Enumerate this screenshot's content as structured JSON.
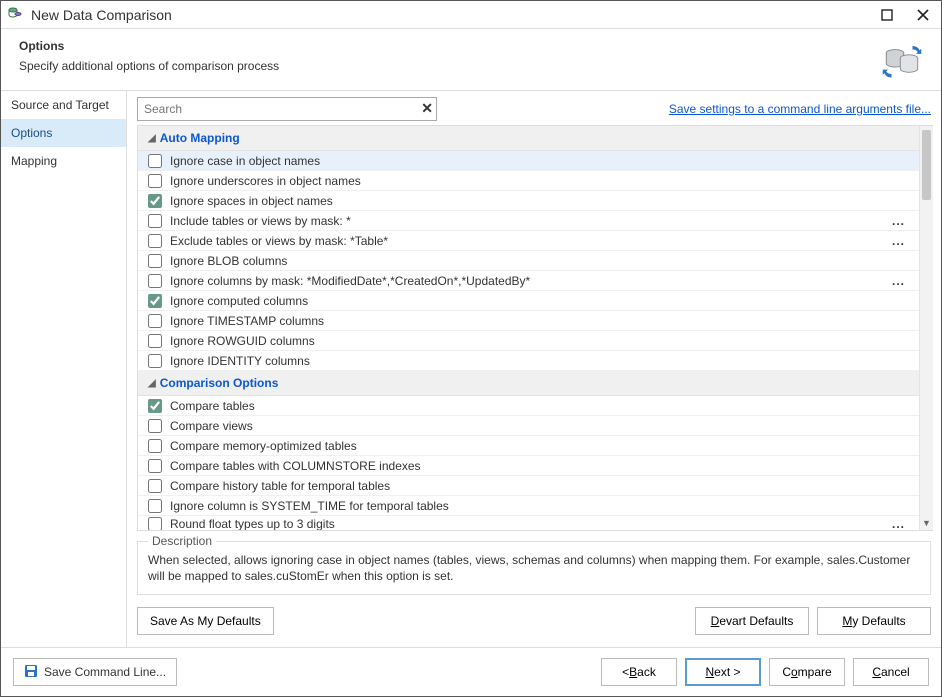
{
  "window": {
    "title": "New Data Comparison",
    "maximize_icon": "maximize-icon",
    "close_icon": "close-icon"
  },
  "header": {
    "title": "Options",
    "subtitle": "Specify additional options of comparison process"
  },
  "sidebar": {
    "items": [
      {
        "label": "Source and Target"
      },
      {
        "label": "Options"
      },
      {
        "label": "Mapping"
      }
    ],
    "active_index": 1
  },
  "search": {
    "placeholder": "Search",
    "value": ""
  },
  "save_link": "Save settings to a command line arguments file...",
  "sections": [
    {
      "title": "Auto Mapping",
      "options": [
        {
          "label": "Ignore case in object names",
          "checked": false,
          "highlight": true
        },
        {
          "label": "Ignore underscores in object names",
          "checked": false
        },
        {
          "label": "Ignore spaces in object names",
          "checked": true
        },
        {
          "label": "Include tables or views by mask: *",
          "checked": false,
          "more": true
        },
        {
          "label": "Exclude tables or views by mask: *Table*",
          "checked": false,
          "more": true
        },
        {
          "label": "Ignore BLOB columns",
          "checked": false
        },
        {
          "label": "Ignore columns by mask: *ModifiedDate*,*CreatedOn*,*UpdatedBy*",
          "checked": false,
          "more": true
        },
        {
          "label": "Ignore computed columns",
          "checked": true
        },
        {
          "label": "Ignore TIMESTAMP columns",
          "checked": false
        },
        {
          "label": "Ignore ROWGUID columns",
          "checked": false
        },
        {
          "label": "Ignore IDENTITY columns",
          "checked": false
        }
      ]
    },
    {
      "title": "Comparison Options",
      "options": [
        {
          "label": "Compare tables",
          "checked": true
        },
        {
          "label": "Compare views",
          "checked": false
        },
        {
          "label": "Compare memory-optimized tables",
          "checked": false
        },
        {
          "label": "Compare tables with COLUMNSTORE indexes",
          "checked": false
        },
        {
          "label": "Compare history table for temporal tables",
          "checked": false
        },
        {
          "label": "Ignore column is SYSTEM_TIME for temporal tables",
          "checked": false
        },
        {
          "label": "Round float types up to 3 digits",
          "checked": false,
          "more": true,
          "cutoff": true
        }
      ]
    }
  ],
  "description": {
    "legend": "Description",
    "text": "When selected, allows ignoring case in object names (tables, views, schemas and columns) when mapping them. For example, sales.Customer will be mapped to sales.cuStomEr when this option is set."
  },
  "defaults_buttons": {
    "save_my": "Save As My Defaults",
    "devart": "Devart Defaults",
    "my": "My Defaults"
  },
  "footer": {
    "save_cmd": "Save Command Line...",
    "back": "< Back",
    "next": "Next >",
    "compare": "Compare",
    "cancel": "Cancel",
    "back_u": "B",
    "next_u": "N",
    "compare_u": "o",
    "cancel_u": "C",
    "my_u": "M",
    "devart_u": "D"
  }
}
